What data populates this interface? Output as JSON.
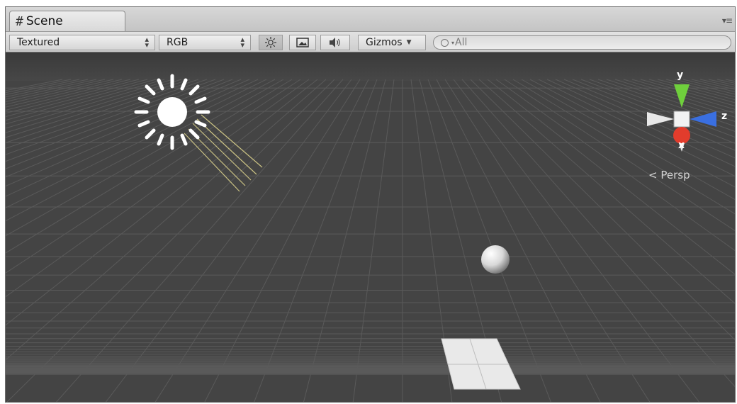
{
  "tab": {
    "title": "Scene",
    "icon": "scene-hash-icon"
  },
  "panel_menu_icon": "panel-options-icon",
  "toolbar": {
    "render_mode": "Textured",
    "channel": "RGB",
    "lighting_icon": "sun-icon",
    "effects_icon": "image-icon",
    "audio_icon": "speaker-icon",
    "gizmos_label": "Gizmos",
    "search_placeholder": "All"
  },
  "viewport": {
    "projection_label": "Persp",
    "axis_labels": {
      "y": "y",
      "z": "z",
      "x": "x"
    },
    "colors": {
      "background": "#444444",
      "grid": "#5a5a5a",
      "axis_y": "#6fcf3c",
      "axis_z": "#3a6fe0",
      "axis_x": "#e23c2c"
    }
  }
}
